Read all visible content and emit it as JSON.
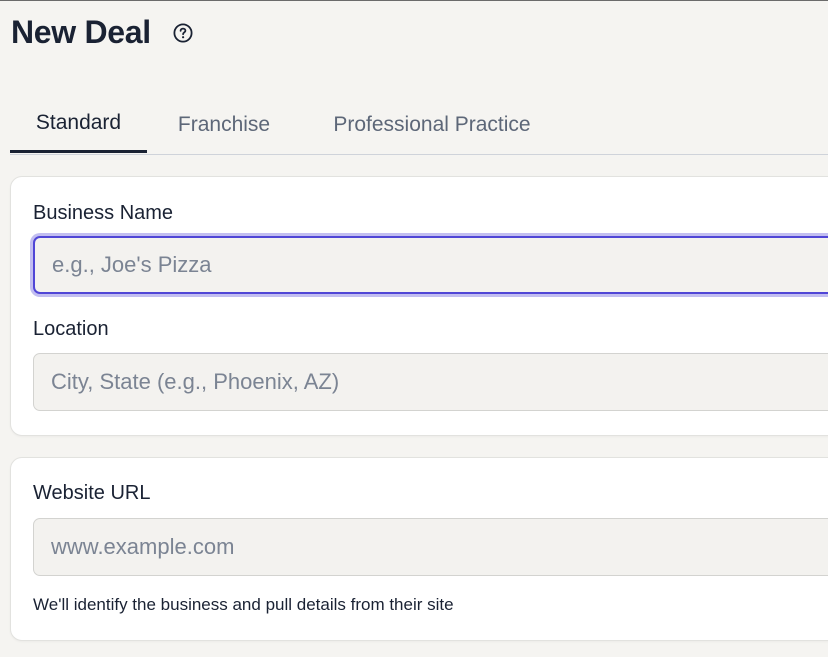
{
  "page": {
    "title": "New Deal",
    "help_icon": "question-circle-icon"
  },
  "tabs": [
    {
      "label": "Standard",
      "active": true
    },
    {
      "label": "Franchise",
      "active": false
    },
    {
      "label": "Professional Practice",
      "active": false
    }
  ],
  "business": {
    "name_label": "Business Name",
    "name_placeholder": "e.g., Joe's Pizza",
    "name_value": "",
    "location_label": "Location",
    "location_placeholder": "City, State (e.g., Phoenix, AZ)",
    "location_value": ""
  },
  "website": {
    "label": "Website URL",
    "placeholder": "www.example.com",
    "value": "",
    "hint": "We'll identify the business and pull details from their site"
  },
  "colors": {
    "focus_ring": "#5046d6",
    "text_primary": "#1a2233",
    "text_muted": "#5d6778",
    "background": "#f5f4f1"
  }
}
